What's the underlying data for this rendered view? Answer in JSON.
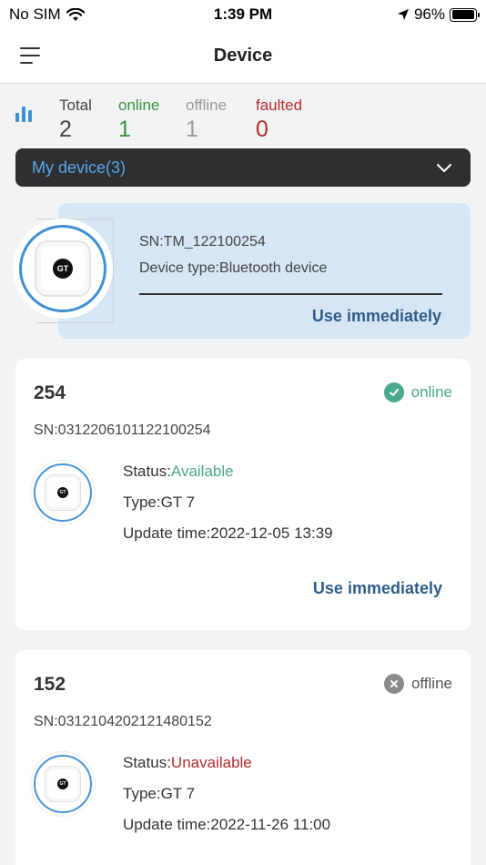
{
  "status_bar": {
    "carrier": "No SIM",
    "time": "1:39 PM",
    "battery_percent": "96%",
    "battery_level": 0.96
  },
  "header": {
    "title": "Device"
  },
  "stats": {
    "total_label": "Total",
    "total_value": "2",
    "online_label": "online",
    "online_value": "1",
    "offline_label": "offline",
    "offline_value": "1",
    "faulted_label": "faulted",
    "faulted_value": "0"
  },
  "device_selector": {
    "label": "My device(3)"
  },
  "bluetooth_card": {
    "sn": "SN:TM_122100254",
    "device_type": "Device type:Bluetooth device",
    "action": "Use immediately",
    "logo_text": "GT"
  },
  "devices": [
    {
      "name": "254",
      "status": "online",
      "sn": "SN:0312206101122100254",
      "status_prefix": "Status:",
      "status_value": "Available",
      "type": "Type:GT 7",
      "update_time": "Update time:2022-12-05 13:39",
      "action": "Use immediately",
      "logo_text": "GT"
    },
    {
      "name": "152",
      "status": "offline",
      "sn": "SN:0312104202121480152",
      "status_prefix": "Status:",
      "status_value": "Unavailable",
      "type": "Type:GT 7",
      "update_time": "Update time:2022-11-26 11:00",
      "logo_text": "GT"
    }
  ],
  "colors": {
    "accent_blue": "#3f8fd2",
    "online_green": "#3e8e3e",
    "available_teal": "#4aa88f",
    "unavailable_red": "#b52a2a",
    "action_blue": "#2f5d8a"
  }
}
